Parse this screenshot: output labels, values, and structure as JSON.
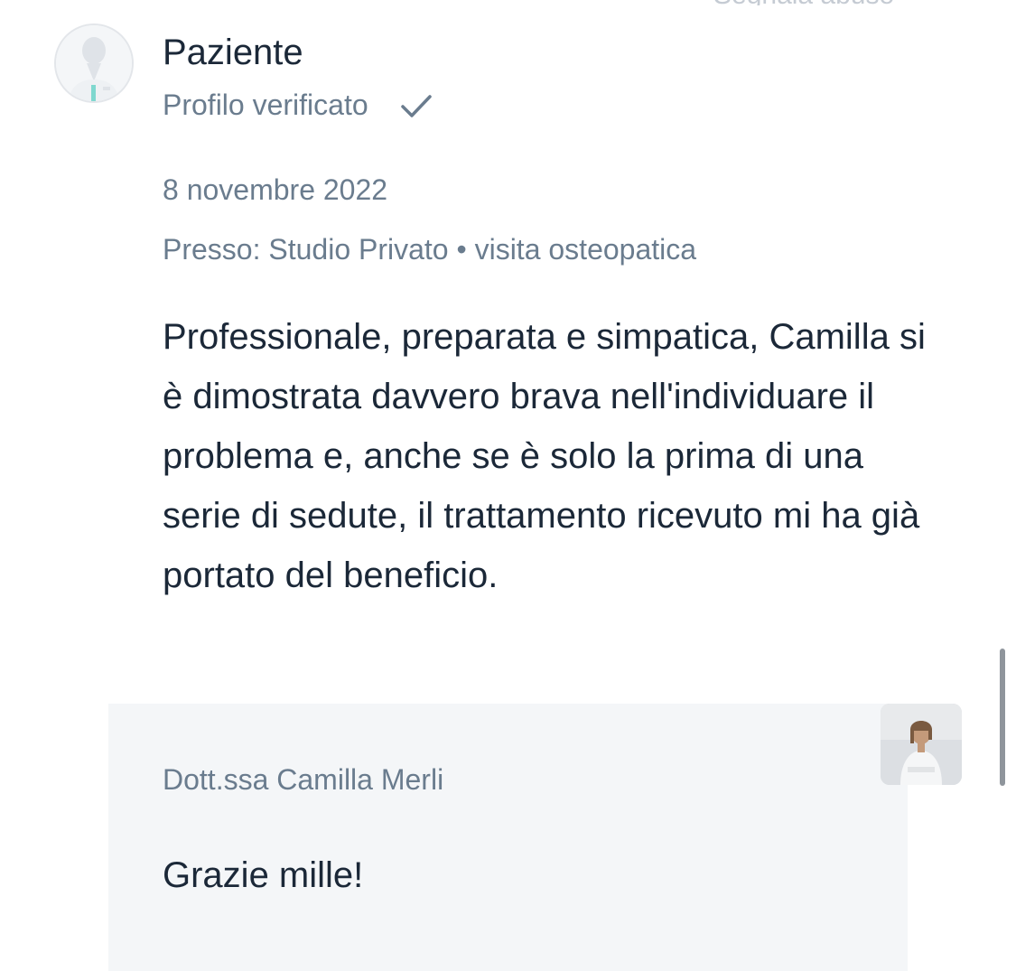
{
  "review": {
    "author": "Paziente",
    "verified_label": "Profilo verificato",
    "date": "8 novembre 2022",
    "location": "Presso: Studio Privato • visita osteopatica",
    "text": "Professionale, preparata e simpatica, Camilla si è dimostrata davvero brava nell'individuare il problema e, anche se è solo la prima di una serie di sedute, il trattamento ricevuto mi ha già portato del beneficio."
  },
  "reply": {
    "author": "Dott.ssa Camilla Merli",
    "text": "Grazie mille!"
  },
  "icons": {
    "avatar": "patient-avatar-icon",
    "verified": "checkmark-icon",
    "doctor": "doctor-photo"
  },
  "colors": {
    "primary_text": "#1b2838",
    "secondary_text": "#6a7c8e",
    "reply_background": "#f4f6f8",
    "accent_teal": "#7fd8cf"
  }
}
